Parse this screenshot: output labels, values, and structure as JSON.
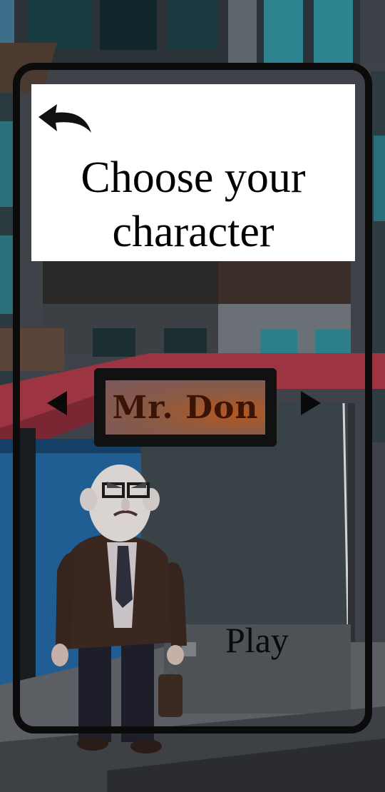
{
  "screen": {
    "back_icon": "back-arrow-icon",
    "title_line1": "Choose your",
    "title_line2": "character",
    "prev_icon": "triangle-left-icon",
    "next_icon": "triangle-right-icon",
    "character_name": "Mr. Don",
    "play_label": "Play"
  },
  "colors": {
    "header_bg": "#ffffff",
    "frame": "#0b0b0b",
    "name_plate": "#8a5a44",
    "name_text": "#3b1408",
    "awning": "#9c3442"
  }
}
